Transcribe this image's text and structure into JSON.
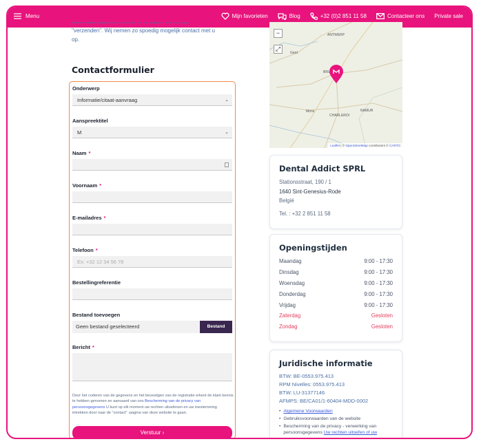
{
  "topbar": {
    "menu_label": "Menu",
    "favorites_label": "Mijn favorieten",
    "blog_label": "Blog",
    "phone_label": "+32 (0)2 851 11 58",
    "contact_label": "Contacteer ons",
    "private_sale_label": "Private sale"
  },
  "intro": {
    "line1": "van onderstaand formulier in te vullen en klik op",
    "line2": "\"verzenden\". Wij nemen zo spoedig mogelijk contact met u",
    "line3": "op."
  },
  "form": {
    "title": "Contactformulier",
    "required_mark": "*",
    "subject_label": "Onderwerp",
    "subject_value": "Informatie/citaat-aanvraag",
    "salutation_label": "Aanspreektitel",
    "salutation_value": "M",
    "name_label": "Naam",
    "firstname_label": "Voornaam",
    "email_label": "E-mailadres",
    "phone_label": "Telefoon",
    "phone_placeholder": "Ex: +32 12 34 56 78",
    "order_ref_label": "Bestellingreferentie",
    "file_label": "Bestand toevoegen",
    "file_value": "Geen bestand geselecteerd",
    "file_button": "Bestand",
    "message_label": "Bericht",
    "note_text_1": "Door het coderen van de gegevens en het bevestigen van de registratie erkent de klant kennis te hebben genomen en aanvaard van ons",
    "note_link": "Bescherming van de privacy van persoonsgegevens",
    "note_text_2": "U kunt op elk moment uw rechten uitoefenen en uw toestemming intrekken door naar de \"contact\" -pagina van deze website te gaan.",
    "submit_label": "Verstuur",
    "submit_icon": "chevron-right-icon"
  },
  "map": {
    "towns": [
      "ANTWERP",
      "Gent",
      "BRUSSELS",
      "Mons",
      "CHARLEROI",
      "NAMUR"
    ],
    "attribution_leaflet": "Leaflet",
    "attribution_sep": " | © ",
    "attribution_osm": "OpenStreetMap",
    "attribution_mid": " contributors © ",
    "attribution_carto": "CARTO",
    "zoom_out": "−",
    "fullscreen": "⤢"
  },
  "company": {
    "title": "Dental Addict SPRL",
    "street": "Stationsstraat, 190 / 1",
    "city": "1640 Sint-Genesius-Rode",
    "country": "België",
    "phone": "Tel. : +32 2 851 11 58"
  },
  "hours": {
    "title": "Openingstijden",
    "days": [
      {
        "day": "Maandag",
        "time": "9:00 - 17:30"
      },
      {
        "day": "Dinsdag",
        "time": "9:00 - 17:30"
      },
      {
        "day": "Woensdag",
        "time": "9:00 - 17:30"
      },
      {
        "day": "Donderdag",
        "time": "9:00 - 17:30"
      },
      {
        "day": "Vrijdag",
        "time": "9:00 - 17:30"
      },
      {
        "day": "Zaterdag",
        "time": "Gesloten"
      },
      {
        "day": "Zondag",
        "time": "Gesloten"
      }
    ]
  },
  "legal": {
    "title": "Juridische informatie",
    "btw": "BTW: BE-0553.975.413",
    "rpm": "RPM Nivelles: 0553.975.413",
    "btw2": "BTW: LU-31377146",
    "afmps": "AFMPS: BE/CA01/1-60404-MDD-0002",
    "link1": "Algemene Voorwaarden",
    "item2": "Gebruiksvoorwaarden van de website",
    "item3_text": "Bescherming van de privacy - verwerking van persoonsgegevens",
    "item3_link": "Uw rechten uitoefen of uw"
  },
  "colors": {
    "brand": "#e8137c",
    "dark_button": "#3a2750",
    "closed": "#e53e5c"
  }
}
